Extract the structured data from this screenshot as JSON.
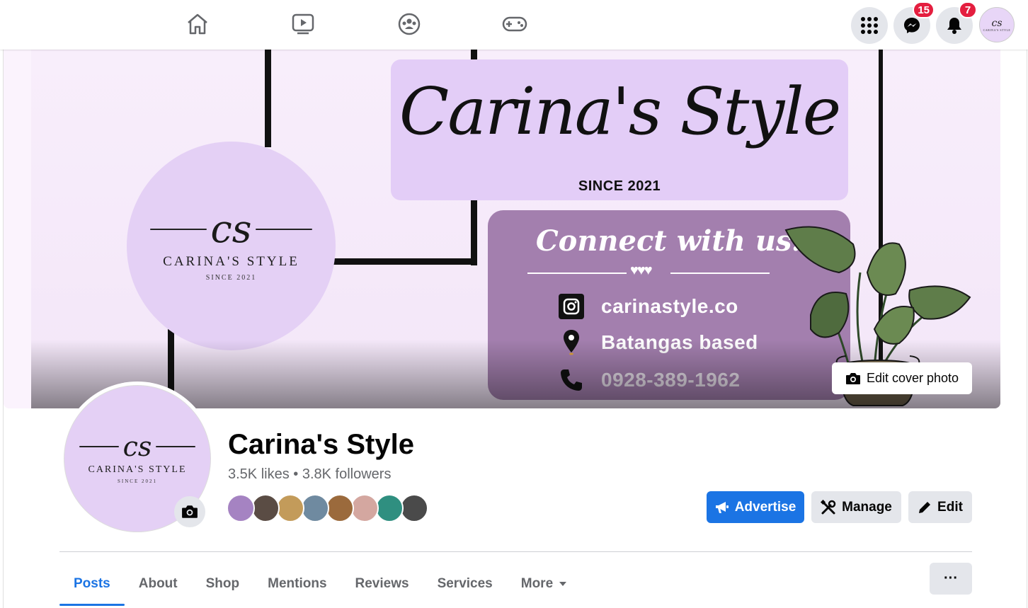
{
  "topnav": {
    "icons": [
      "home-icon",
      "watch-icon",
      "groups-icon",
      "gaming-icon"
    ],
    "menu_icon": "grid-menu-icon",
    "messenger_icon": "messenger-icon",
    "messenger_badge": "15",
    "notifications_icon": "bell-icon",
    "notifications_badge": "7"
  },
  "cover": {
    "logo_mono": "cs",
    "logo_name": "CARINA'S STYLE",
    "logo_since": "SINCE 2021",
    "title_script": "Carina's Style",
    "since": "SINCE 2021",
    "connect_title": "Connect with us:",
    "hearts": "♥♥♥",
    "contact": [
      {
        "icon": "instagram-icon",
        "text": "carinastyle.co"
      },
      {
        "icon": "location-pin-icon",
        "text": "Batangas based"
      },
      {
        "icon": "phone-icon",
        "text": "0928-389-1962"
      }
    ],
    "edit_cover_label": "Edit cover photo"
  },
  "profile": {
    "name": "Carina's Style",
    "stats": "3.5K likes • 3.8K followers",
    "avatar_mono": "cs",
    "avatar_name": "CARINA'S STYLE",
    "avatar_since": "SINCE 2021"
  },
  "actions": {
    "advertise": "Advertise",
    "manage": "Manage",
    "edit": "Edit"
  },
  "tabs": [
    "Posts",
    "About",
    "Shop",
    "Mentions",
    "Reviews",
    "Services",
    "More"
  ],
  "more_options_label": "···",
  "colors": {
    "accent": "#1b74e4",
    "badge": "#e41e3f",
    "lavender": "#e4d0f5",
    "purple_box": "#a37fae"
  }
}
